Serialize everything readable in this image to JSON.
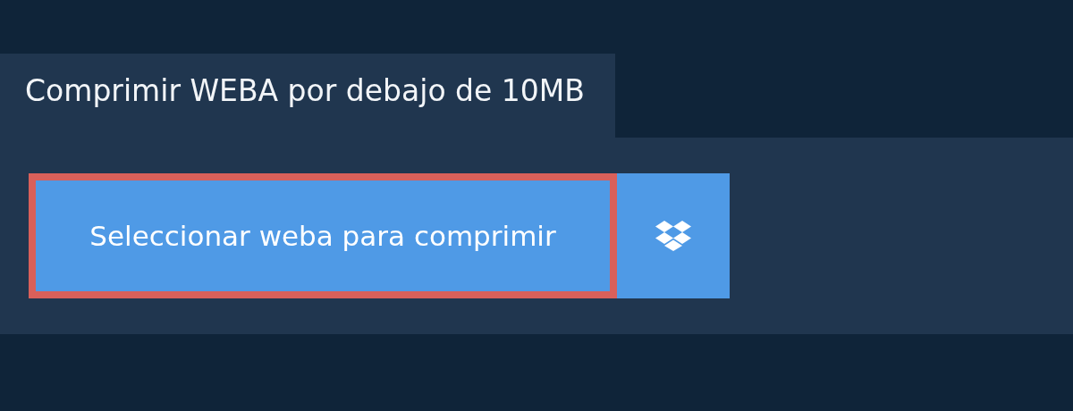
{
  "title": "Comprimir WEBA por debajo de 10MB",
  "select_button": {
    "label": "Seleccionar weba para comprimir",
    "focused": true
  }
}
